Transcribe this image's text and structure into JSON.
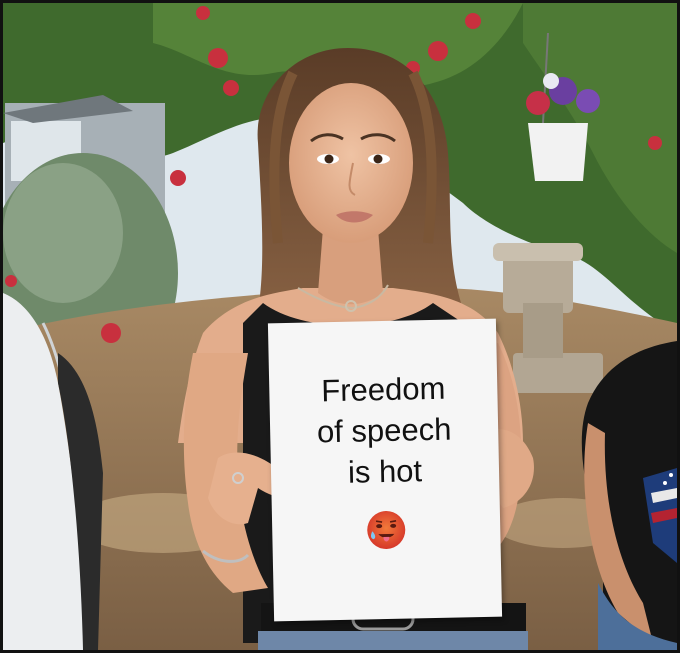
{
  "sign": {
    "lines": [
      "Freedom",
      "of speech",
      "is hot"
    ],
    "emoji": "hot-face-emoji"
  },
  "colors": {
    "frame": "#111111",
    "sky": "#dfe8ee",
    "foliage": "#3f6a2d",
    "soil": "#8a6f52",
    "flowers": "#c8303e",
    "hair": "#6b4a32",
    "skin": "#e3ad8c",
    "top": "#1a1a1a",
    "sign_paper": "#f6f6f6"
  }
}
